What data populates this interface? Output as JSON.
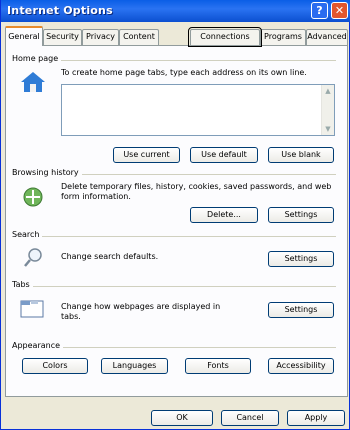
{
  "window": {
    "title": "Internet Options"
  },
  "title_buttons": {
    "help": "?",
    "close": "✕"
  },
  "tabs": [
    {
      "label": "General",
      "active": true
    },
    {
      "label": "Security"
    },
    {
      "label": "Privacy"
    },
    {
      "label": "Content"
    },
    {
      "label": "Connections",
      "highlighted": true
    },
    {
      "label": "Programs"
    },
    {
      "label": "Advanced"
    }
  ],
  "home_page": {
    "group_label": "Home page",
    "description": "To create home page tabs, type each address on its own line.",
    "textarea_value": "",
    "buttons": {
      "use_current": "Use current",
      "use_default": "Use default",
      "use_blank": "Use blank"
    }
  },
  "browsing_history": {
    "group_label": "Browsing history",
    "description": "Delete temporary files, history, cookies, saved passwords, and web form information.",
    "buttons": {
      "delete": "Delete...",
      "settings": "Settings"
    }
  },
  "search": {
    "group_label": "Search",
    "description": "Change search defaults.",
    "buttons": {
      "settings": "Settings"
    }
  },
  "tabs_section": {
    "group_label": "Tabs",
    "description": "Change how webpages are displayed in tabs.",
    "buttons": {
      "settings": "Settings"
    }
  },
  "appearance": {
    "group_label": "Appearance",
    "buttons": {
      "colors": "Colors",
      "languages": "Languages",
      "fonts": "Fonts",
      "accessibility": "Accessibility"
    }
  },
  "footer": {
    "ok": "OK",
    "cancel": "Cancel",
    "apply": "Apply"
  },
  "colors": {
    "titlebar": "#0a5ee6",
    "active_tab_accent": "#e68b2c",
    "button_border": "#003c74"
  }
}
